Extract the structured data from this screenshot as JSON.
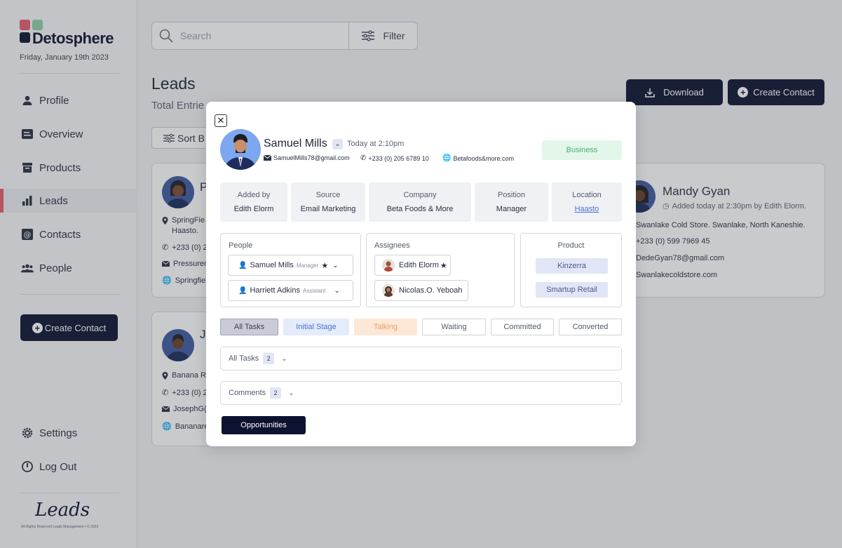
{
  "app": {
    "name": "Detosphere",
    "date": "Friday, January 19th 2023"
  },
  "sidebar": {
    "items": [
      {
        "label": "Profile"
      },
      {
        "label": "Overview"
      },
      {
        "label": "Products"
      },
      {
        "label": "Leads"
      },
      {
        "label": "Contacts"
      },
      {
        "label": "People"
      }
    ],
    "create_label": "Create Contact",
    "settings_label": "Settings",
    "logout_label": "Log Out",
    "footer_logo": "Leads",
    "footer_text": "All Rights Reserved Leads Management • © 2023"
  },
  "search": {
    "placeholder": "Search",
    "filter_label": "Filter"
  },
  "page": {
    "title": "Leads",
    "subtitle": "Total Entrie",
    "download_label": "Download",
    "create_label": "Create Contact",
    "sort_label": "Sort B"
  },
  "cards": {
    "left_top": {
      "name": "P",
      "address1": "SpringFie",
      "address2": "Haasto.",
      "phone": "+233 (0) 2",
      "email": "Pressurem",
      "web": "Springfiel"
    },
    "left_bottom": {
      "name": "J",
      "address": "Banana R",
      "phone": "+233 (0) 2",
      "email": "JosephG(",
      "web": "Bananare"
    },
    "right": {
      "name": "Mandy Gyan",
      "added": "Added today at 2:30pm by Edith Elorm.",
      "address": "Swanlake Cold Store. Swanlake, North Kaneshie.",
      "phone": "+233 (0) 599 7969 45",
      "email": "DedeGyan78@gmail.com",
      "web": "Swanlakecoldstore.com"
    }
  },
  "modal": {
    "name": "Samuel Mills",
    "time": "Today at 2:10pm",
    "email": "SamuelMills78@gmail.com",
    "phone": "+233 (0) 205 6789 10",
    "website": "Betafoods&more.com",
    "badge": "Business",
    "info": [
      {
        "label": "Added by",
        "value": "Edith Elorm"
      },
      {
        "label": "Source",
        "value": "Email Marketing"
      },
      {
        "label": "Company",
        "value": "Beta Foods & More"
      },
      {
        "label": "Position",
        "value": "Manager"
      },
      {
        "label": "Location",
        "value": "Haasto"
      }
    ],
    "people": {
      "title": "People",
      "entries": [
        {
          "name": "Samuel Mills",
          "role": "Manager"
        },
        {
          "name": "Harriett Adkins",
          "role": "Assistant"
        }
      ]
    },
    "assignees": {
      "title": "Assignees",
      "entries": [
        {
          "name": "Edith Elorm"
        },
        {
          "name": "Nicolas.O. Yeboah"
        }
      ]
    },
    "product": {
      "title": "Product",
      "entries": [
        {
          "name": "Kinzerra"
        },
        {
          "name": "Smartup Retail"
        }
      ]
    },
    "stages": [
      {
        "label": "All Tasks"
      },
      {
        "label": "Initial Stage"
      },
      {
        "label": "Talking"
      },
      {
        "label": "Waiting"
      },
      {
        "label": "Committed"
      },
      {
        "label": "Converted"
      }
    ],
    "tasks": {
      "label": "All Tasks",
      "count": "2"
    },
    "comments": {
      "label": "Comments",
      "count": "2"
    },
    "opportunities_label": "Opportunities"
  },
  "colors": {
    "primary": "#0c1330",
    "accent": "#e35d6a",
    "business_bg": "#e3f6ea",
    "business_text": "#49b06f"
  }
}
